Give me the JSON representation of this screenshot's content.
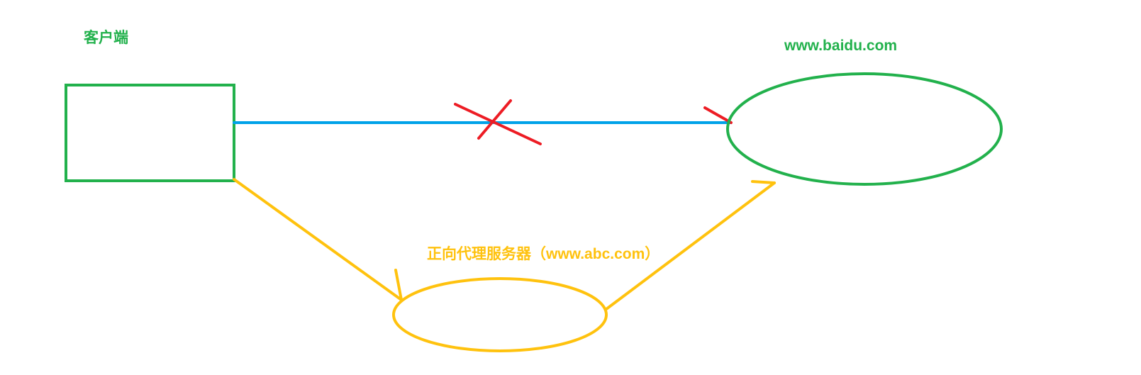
{
  "labels": {
    "client": "客户端",
    "server": "www.baidu.com",
    "proxy": "正向代理服务器（www.abc.com）"
  },
  "colors": {
    "green": "#22b14c",
    "blue": "#00a2e8",
    "red": "#ed1c24",
    "yellow": "#ffc20e"
  }
}
